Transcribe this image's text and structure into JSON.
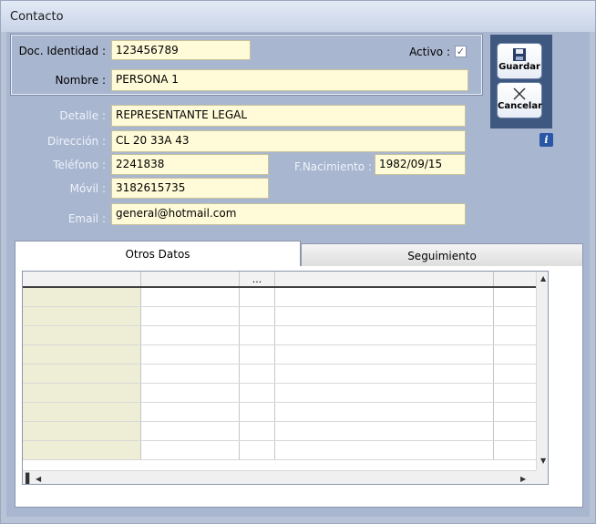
{
  "window": {
    "title": "Contacto"
  },
  "form": {
    "doc_label": "Doc. Identidad :",
    "doc_value": "123456789",
    "activo_label": "Activo :",
    "activo_checked": true,
    "nombre_label": "Nombre :",
    "nombre_value": "PERSONA 1",
    "detalle_label": "Detalle :",
    "detalle_value": "REPRESENTANTE LEGAL",
    "direccion_label": "Dirección :",
    "direccion_value": "CL 20 33A 43",
    "telefono_label": "Teléfono :",
    "telefono_value": "2241838",
    "nacimiento_label": "F.Nacimiento :",
    "nacimiento_value": "1982/09/15",
    "movil_label": "Móvil :",
    "movil_value": "3182615735",
    "email_label": "Email :",
    "email_value": "general@hotmail.com"
  },
  "buttons": {
    "guardar": "Guardar",
    "cancelar": "Cancelar"
  },
  "tabs": [
    {
      "label": "Otros Datos",
      "active": true
    },
    {
      "label": "Seguimiento",
      "active": false
    }
  ],
  "grid": {
    "header_cells": [
      "",
      "",
      "...",
      "",
      ""
    ],
    "row_count": 9
  },
  "colors": {
    "field_bg": "#fffbd8",
    "panel_bg": "#a9b6cf",
    "button_panel": "#3f587f",
    "info_icon": "#2a56a6"
  }
}
